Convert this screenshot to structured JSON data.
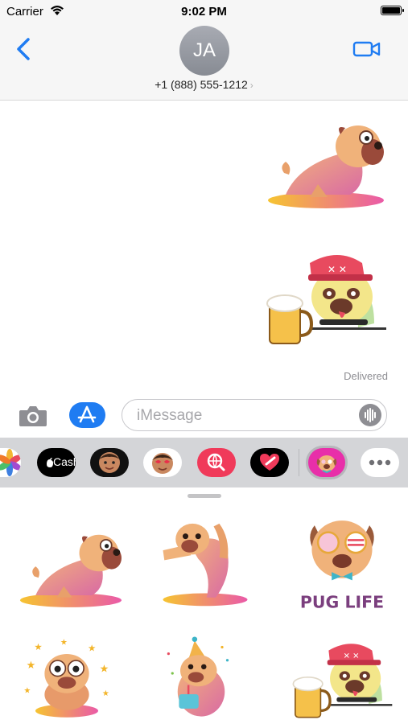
{
  "status_bar": {
    "carrier": "Carrier",
    "time": "9:02 PM"
  },
  "header": {
    "avatar_initials": "JA",
    "contact": "+1 (888) 555-1212",
    "chevron": "›"
  },
  "thread": {
    "messages": [
      {
        "type": "sticker",
        "name": "yoga-pug"
      },
      {
        "type": "sticker",
        "name": "beer-pug"
      }
    ],
    "delivered_label": "Delivered"
  },
  "composer": {
    "placeholder": "iMessage",
    "value": ""
  },
  "app_strip": {
    "apps": [
      {
        "name": "photos-icon"
      },
      {
        "name": "apple-cash-icon",
        "label": "Cash"
      },
      {
        "name": "memoji-icon"
      },
      {
        "name": "memoji-stickers-icon"
      },
      {
        "name": "web-images-icon"
      },
      {
        "name": "digital-touch-icon"
      },
      {
        "name": "pug-stickers-icon"
      },
      {
        "name": "more-icon"
      }
    ]
  },
  "drawer": {
    "stickers": [
      {
        "name": "yoga-pug"
      },
      {
        "name": "stretch-pug"
      },
      {
        "name": "pug-life"
      },
      {
        "name": "starry-pug"
      },
      {
        "name": "party-pug"
      },
      {
        "name": "beer-pug"
      }
    ],
    "pug_life_text": "PUG LIFE"
  },
  "colors": {
    "accent": "#1f7cf2",
    "pug_body": "#e8a06a",
    "pug_face": "#9a4a3a",
    "sticker_mat": "#f6a330"
  }
}
